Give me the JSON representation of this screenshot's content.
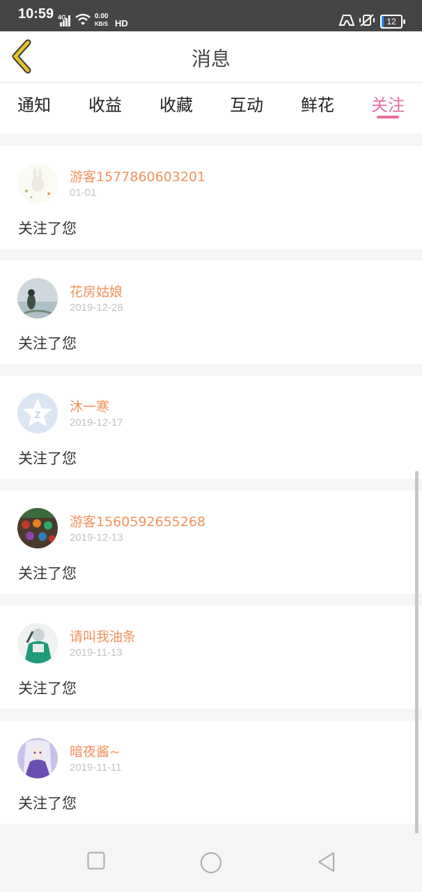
{
  "status_bar": {
    "time": "10:59",
    "network": "4G",
    "speed_value": "0.00",
    "speed_unit": "KB/S",
    "hd": "HD",
    "battery": "12"
  },
  "header": {
    "title": "消息"
  },
  "tabs": [
    {
      "label": "通知"
    },
    {
      "label": "收益"
    },
    {
      "label": "收藏"
    },
    {
      "label": "互动"
    },
    {
      "label": "鲜花"
    },
    {
      "label": "关注",
      "active": true
    }
  ],
  "messages": [
    {
      "username": "游客1577860603201",
      "date": "01-01",
      "text": "关注了您"
    },
    {
      "username": "花房姑娘",
      "date": "2019-12-28",
      "text": "关注了您"
    },
    {
      "username": "沐一寒",
      "date": "2019-12-17",
      "text": "关注了您"
    },
    {
      "username": "游客1560592655268",
      "date": "2019-12-13",
      "text": "关注了您"
    },
    {
      "username": "请叫我油条",
      "date": "2019-11-13",
      "text": "关注了您"
    },
    {
      "username": "暗夜酱~",
      "date": "2019-11-11",
      "text": "关注了您"
    }
  ],
  "colors": {
    "accent": "#e96ca0",
    "username": "#f0925a",
    "back_arrow": "#e3c22f"
  }
}
